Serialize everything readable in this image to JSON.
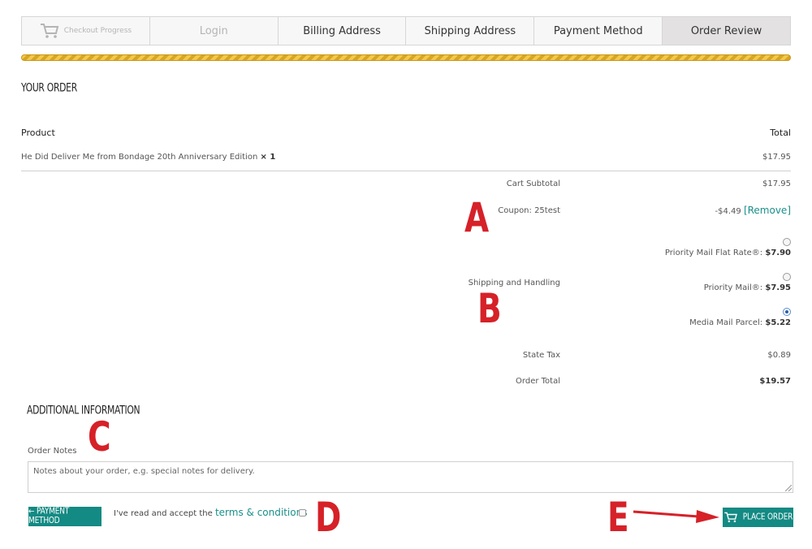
{
  "progress": {
    "steps": [
      {
        "label": "Checkout Progress"
      },
      {
        "label": "Login"
      },
      {
        "label": "Billing Address"
      },
      {
        "label": "Shipping Address"
      },
      {
        "label": "Payment Method"
      },
      {
        "label": "Order Review"
      }
    ]
  },
  "order": {
    "title": "YOUR ORDER",
    "col_product": "Product",
    "col_total": "Total",
    "item_name": "He Did Deliver Me from Bondage 20th Anniversary Edition",
    "item_qty": "× 1",
    "item_total": "$17.95",
    "subtotal_label": "Cart Subtotal",
    "subtotal_value": "$17.95",
    "coupon_label": "Coupon: 25test",
    "coupon_value": "-$4.49",
    "coupon_remove": "[Remove]",
    "shipping_label": "Shipping and Handling",
    "shipping_options": [
      {
        "name": "Priority Mail Flat Rate®:",
        "price": "$7.90",
        "selected": false
      },
      {
        "name": "Priority Mail®:",
        "price": "$7.95",
        "selected": false
      },
      {
        "name": "Media Mail Parcel:",
        "price": "$5.22",
        "selected": true
      }
    ],
    "tax_label": "State Tax",
    "tax_value": "$0.89",
    "total_label": "Order Total",
    "total_value": "$19.57"
  },
  "additional": {
    "title": "ADDITIONAL INFORMATION",
    "notes_label": "Order Notes",
    "notes_placeholder": "Notes about your order, e.g. special notes for delivery."
  },
  "footer": {
    "back_button": "← PAYMENT METHOD",
    "terms_prefix": "I've read and accept the",
    "terms_link": "terms & conditions",
    "place_order": "PLACE ORDER"
  },
  "annotations": {
    "a": "A",
    "b": "B",
    "c": "C",
    "d": "D",
    "e": "E"
  },
  "colors": {
    "accent_teal": "#138a83",
    "annotation_red": "#d62128",
    "progress_gold": "#f2c94c"
  }
}
